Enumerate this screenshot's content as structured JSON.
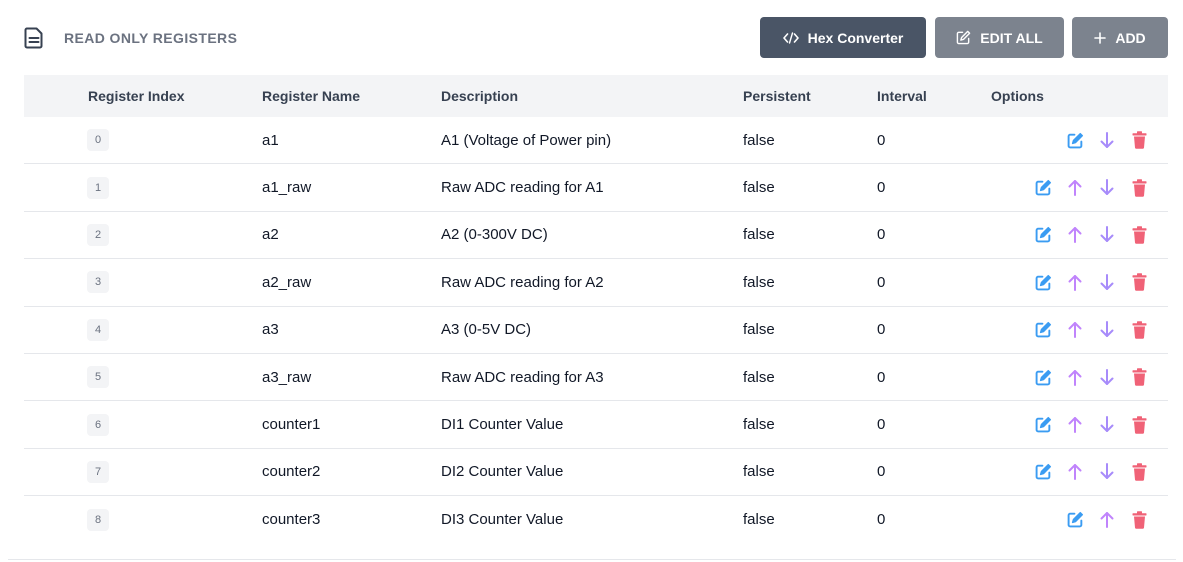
{
  "header": {
    "title": "READ ONLY REGISTERS",
    "hex_converter_label": "Hex Converter",
    "edit_all_label": "EDIT ALL",
    "add_label": "ADD"
  },
  "table": {
    "columns": {
      "index": "Register Index",
      "name": "Register Name",
      "description": "Description",
      "persistent": "Persistent",
      "interval": "Interval",
      "options": "Options"
    },
    "rows": [
      {
        "index": "0",
        "name": "a1",
        "description": "A1 (Voltage of Power pin)",
        "persistent": "false",
        "interval": "0",
        "can_up": false,
        "can_down": true
      },
      {
        "index": "1",
        "name": "a1_raw",
        "description": "Raw ADC reading for A1",
        "persistent": "false",
        "interval": "0",
        "can_up": true,
        "can_down": true
      },
      {
        "index": "2",
        "name": "a2",
        "description": "A2 (0-300V DC)",
        "persistent": "false",
        "interval": "0",
        "can_up": true,
        "can_down": true
      },
      {
        "index": "3",
        "name": "a2_raw",
        "description": "Raw ADC reading for A2",
        "persistent": "false",
        "interval": "0",
        "can_up": true,
        "can_down": true
      },
      {
        "index": "4",
        "name": "a3",
        "description": "A3 (0-5V DC)",
        "persistent": "false",
        "interval": "0",
        "can_up": true,
        "can_down": true
      },
      {
        "index": "5",
        "name": "a3_raw",
        "description": "Raw ADC reading for A3",
        "persistent": "false",
        "interval": "0",
        "can_up": true,
        "can_down": true
      },
      {
        "index": "6",
        "name": "counter1",
        "description": "DI1 Counter Value",
        "persistent": "false",
        "interval": "0",
        "can_up": true,
        "can_down": true
      },
      {
        "index": "7",
        "name": "counter2",
        "description": "DI2 Counter Value",
        "persistent": "false",
        "interval": "0",
        "can_up": true,
        "can_down": true
      },
      {
        "index": "8",
        "name": "counter3",
        "description": "DI3 Counter Value",
        "persistent": "false",
        "interval": "0",
        "can_up": true,
        "can_down": false
      }
    ]
  },
  "colors": {
    "edit_icon": "#3b9cf2",
    "up_icon": "#c084fc",
    "down_icon": "#a78bfa",
    "delete_icon": "#f06277",
    "hex_button_bg": "#4a5566",
    "secondary_button_bg": "#7c838e"
  }
}
